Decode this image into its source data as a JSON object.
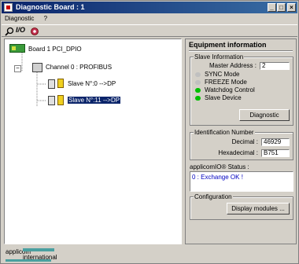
{
  "window": {
    "title": "Diagnostic Board : 1"
  },
  "menu": {
    "items": [
      "Diagnostic",
      "?"
    ]
  },
  "toolbar": {
    "io_label": "I/O"
  },
  "tree": {
    "board": "Board 1 PCI_DPIO",
    "channel": "Channel 0 : PROFIBUS",
    "slaves": [
      "Slave N°:0 -->DP",
      "Slave N°:11 -->DP"
    ]
  },
  "equipment": {
    "heading": "Equipment information",
    "slave_info": {
      "label": "Slave Information",
      "master_address_label": "Master Address :",
      "master_address_value": "2",
      "options": [
        {
          "label": "SYNC Mode",
          "state": "off"
        },
        {
          "label": "FREEZE Mode",
          "state": "off"
        },
        {
          "label": "Watchdog Control",
          "state": "on"
        },
        {
          "label": "Slave Device",
          "state": "on"
        }
      ],
      "diagnostic_button": "Diagnostic"
    },
    "identification": {
      "label": "Identification Number",
      "decimal_label": "Decimal :",
      "decimal_value": "46929",
      "hex_label": "Hexadecimal :",
      "hex_value": "B751"
    },
    "status": {
      "label": "applicomIO® Status :",
      "value": "0 : Exchange OK !"
    },
    "configuration": {
      "label": "Configuration",
      "display_modules_button": "Display modules ..."
    }
  },
  "logo": {
    "line1": "applicom",
    "line2": "international"
  },
  "colors": {
    "led_on": "#00c000",
    "led_off": "#c0c0c0",
    "selection": "#0a246a",
    "status_text": "#0000c0"
  }
}
